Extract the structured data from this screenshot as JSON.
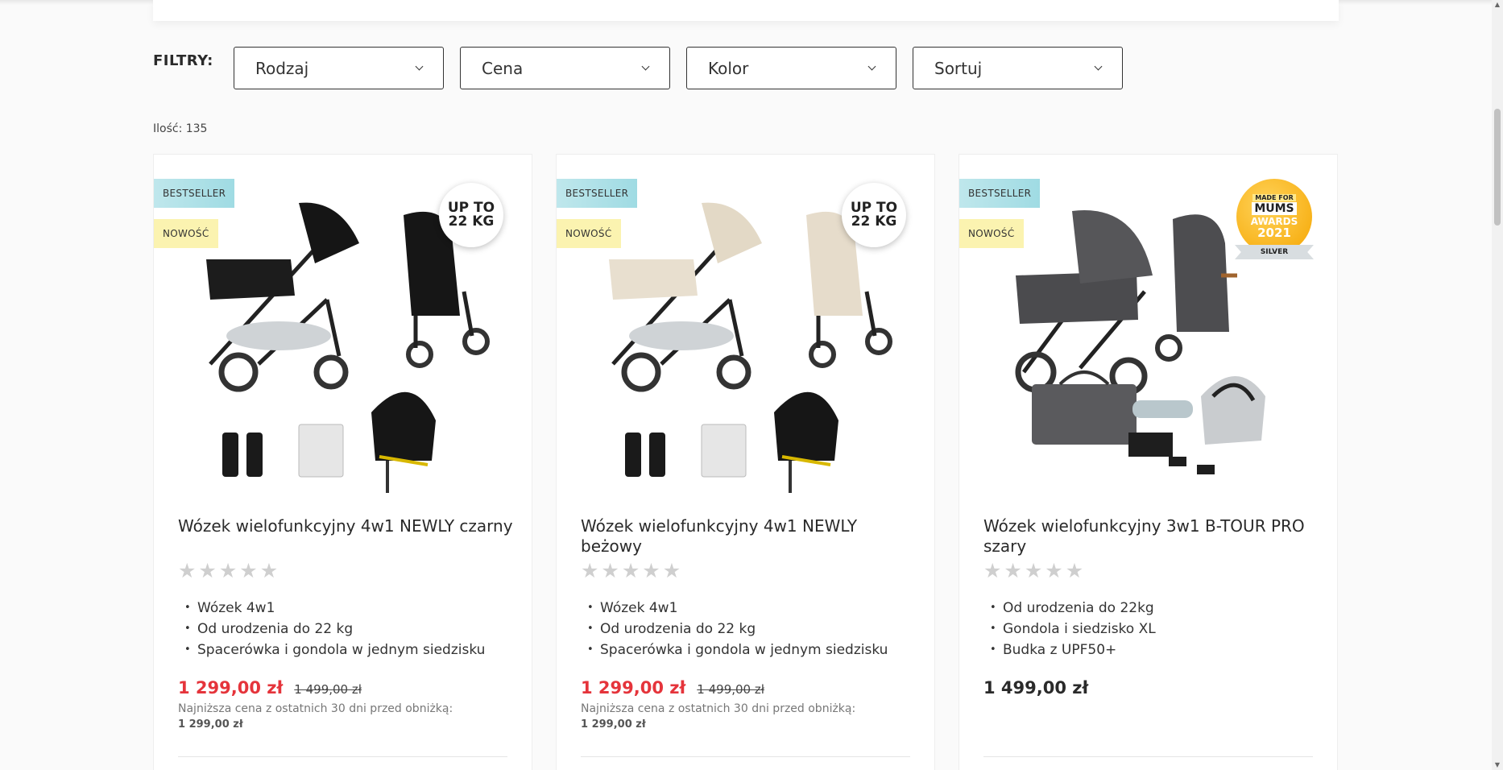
{
  "filters": {
    "label": "FILTRY:",
    "selects": [
      {
        "label": "Rodzaj"
      },
      {
        "label": "Cena"
      },
      {
        "label": "Kolor"
      },
      {
        "label": "Sortuj"
      }
    ]
  },
  "count_text": "Ilość: 135",
  "products": [
    {
      "badge_bestseller": "BESTSELLER",
      "badge_new": "NOWOŚĆ",
      "weight_line1": "UP TO",
      "weight_line2": "22 KG",
      "title": "Wózek wielofunkcyjny 4w1 NEWLY czarny",
      "features": [
        "Wózek 4w1",
        "Od urodzenia do 22 kg",
        "Spacerówka i gondola w jednym siedzisku"
      ],
      "price": "1 299,00 zł",
      "old_price": "1 499,00 zł",
      "lowest_label": "Najniższa cena z ostatnich 30 dni przed obniżką:",
      "lowest_value": "1 299,00 zł"
    },
    {
      "badge_bestseller": "BESTSELLER",
      "badge_new": "NOWOŚĆ",
      "weight_line1": "UP TO",
      "weight_line2": "22 KG",
      "title": "Wózek wielofunkcyjny 4w1 NEWLY beżowy",
      "features": [
        "Wózek 4w1",
        "Od urodzenia do 22 kg",
        "Spacerówka i gondola w jednym siedzisku"
      ],
      "price": "1 299,00 zł",
      "old_price": "1 499,00 zł",
      "lowest_label": "Najniższa cena z ostatnich 30 dni przed obniżką:",
      "lowest_value": "1 299,00 zł"
    },
    {
      "badge_bestseller": "BESTSELLER",
      "badge_new": "NOWOŚĆ",
      "award_line1": "MADE FOR",
      "award_line2": "MUMS",
      "award_line3": "AWARDS",
      "award_line4": "2021",
      "award_line5": "SILVER",
      "title": "Wózek wielofunkcyjny 3w1 B-TOUR PRO szary",
      "features": [
        "Od urodzenia do 22kg",
        "Gondola i siedzisko XL",
        "Budka z UPF50+"
      ],
      "price": "1 499,00 zł"
    }
  ],
  "colors": {
    "sale_price": "#e5343b",
    "bestseller_badge": "#9fdbe3",
    "new_badge": "#fbf3b0",
    "award": "#f5a500"
  }
}
